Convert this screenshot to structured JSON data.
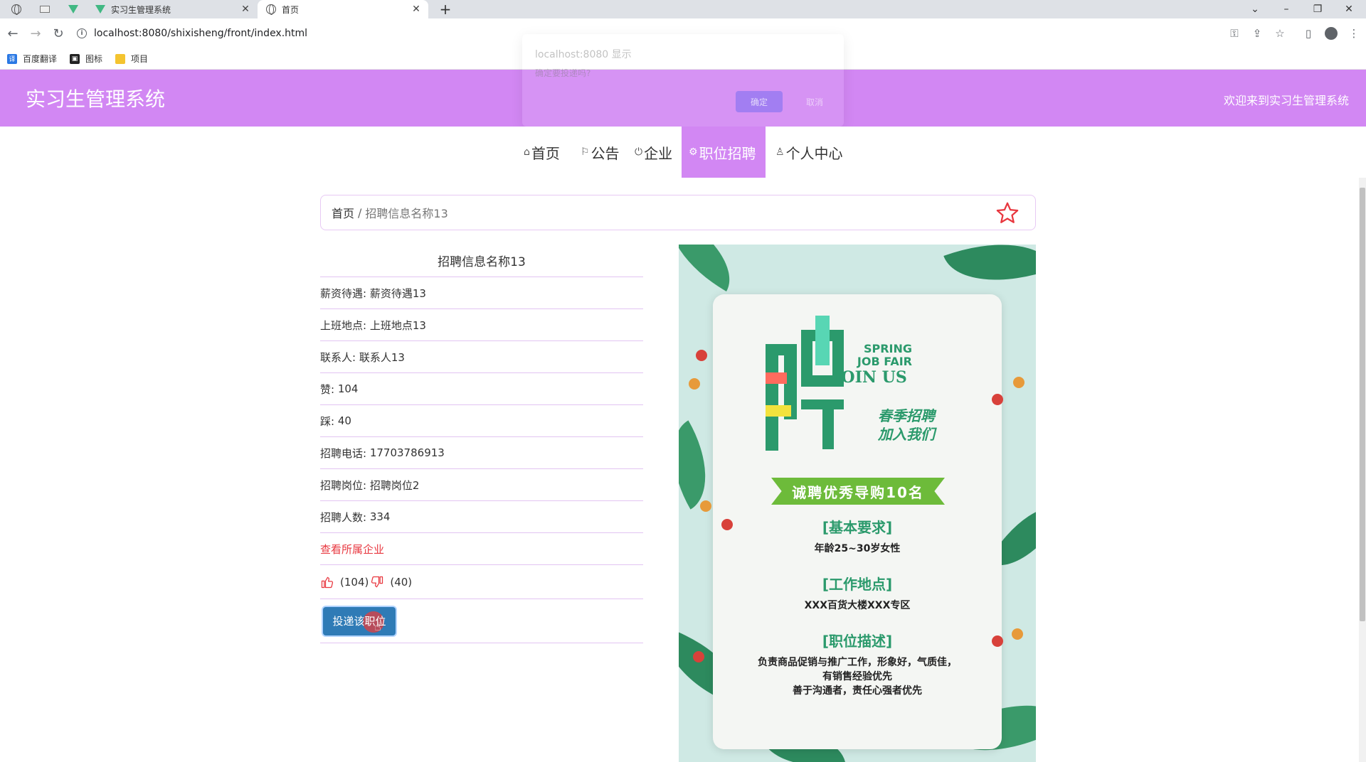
{
  "browser": {
    "tabs": [
      {
        "title": "实习生管理系统",
        "icon": "vue-logo-icon"
      },
      {
        "title": "首页",
        "icon": "globe-icon",
        "active": true
      }
    ],
    "close_symbol": "✕",
    "new_tab_symbol": "+",
    "url": "localhost:8080/shixisheng/front/index.html",
    "bookmarks": [
      {
        "label": "百度翻译",
        "icon": "translate-icon"
      },
      {
        "label": "图标",
        "icon": "image-icon"
      },
      {
        "label": "项目",
        "icon": "folder-icon"
      }
    ]
  },
  "dialog": {
    "title": "localhost:8080 显示",
    "message": "确定要投递吗?",
    "ok_label": "确定",
    "cancel_label": "取消"
  },
  "header": {
    "title": "实习生管理系统",
    "welcome": "欢迎来到实习生管理系统",
    "accent_color": "#d287f3"
  },
  "menu": {
    "items": [
      {
        "label": "首页",
        "icon": "home-icon"
      },
      {
        "label": "公告",
        "icon": "flag-icon"
      },
      {
        "label": "企业",
        "icon": "power-icon"
      },
      {
        "label": "职位招聘",
        "icon": "gear-icon",
        "active": true
      },
      {
        "label": "个人中心",
        "icon": "user-icon"
      }
    ]
  },
  "breadcrumb": {
    "home": "首页",
    "separator": "/",
    "current": "招聘信息名称13"
  },
  "job": {
    "title": "招聘信息名称13",
    "fields": [
      {
        "label": "薪资待遇",
        "value": "薪资待遇13"
      },
      {
        "label": "上班地点",
        "value": "上班地点13"
      },
      {
        "label": "联系人",
        "value": "联系人13"
      },
      {
        "label": "赞",
        "value": "104"
      },
      {
        "label": "踩",
        "value": "40"
      },
      {
        "label": "招聘电话",
        "value": "17703786913"
      },
      {
        "label": "招聘岗位",
        "value": "招聘岗位2"
      },
      {
        "label": "招聘人数",
        "value": "334"
      }
    ],
    "company_link": "查看所属企业",
    "likes": "(104)",
    "dislikes": "(40)",
    "apply_label": "投递该职位"
  },
  "poster": {
    "big_char": "聘",
    "en_line1": "SPRING",
    "en_line2": "JOB FAIR",
    "en_line3": "JOIN US",
    "cn_line1": "春季招聘",
    "cn_line2": "加入我们",
    "banner": "诚聘优秀导购10名",
    "req_title": "[基本要求]",
    "req_text": "年龄25~30岁女性",
    "loc_title": "[工作地点]",
    "loc_text": "XXX百货大楼XXX专区",
    "desc_title": "[职位描述]",
    "desc_line1": "负责商品促销与推广工作，形象好，气质佳，",
    "desc_line2": "有销售经验优先",
    "desc_line3": "善于沟通者，责任心强者优先"
  }
}
